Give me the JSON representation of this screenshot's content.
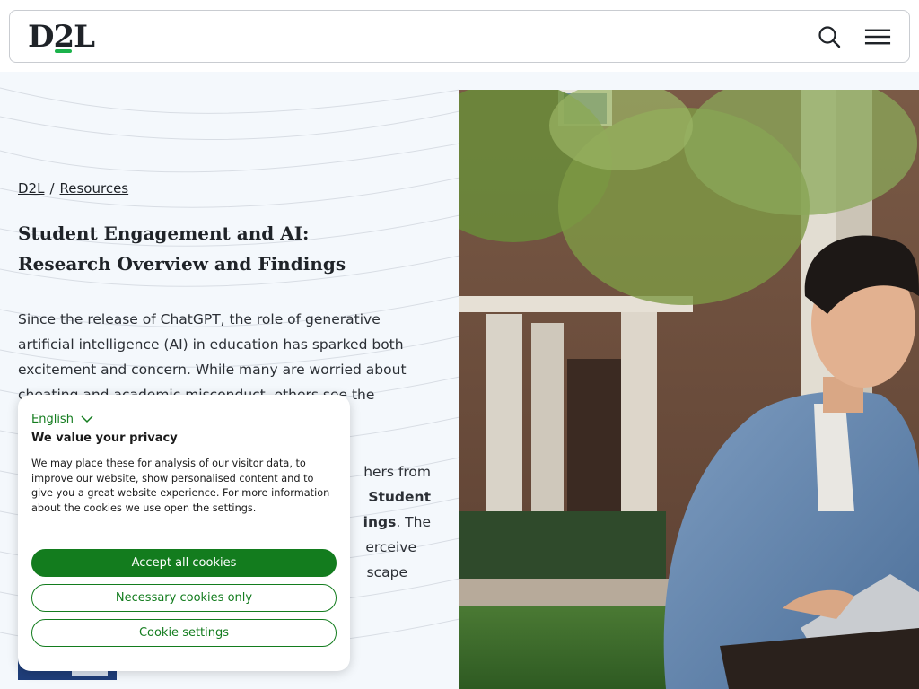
{
  "header": {
    "logo_text_d": "D",
    "logo_text_2": "2",
    "logo_text_l": "L",
    "search_icon": "search-icon",
    "menu_icon": "hamburger-menu-icon"
  },
  "breadcrumb": {
    "home": "D2L",
    "separator": "/",
    "current": "Resources"
  },
  "page": {
    "title_line1": "Student Engagement and AI:",
    "title_line2": "Research Overview and Findings",
    "intro": "Since the release of ChatGPT, the role of generative artificial intelligence (AI) in education has sparked both excitement and concern. While many are worried about cheating and academic misconduct, others see the immense potential for AI",
    "partial_line1": "hers from",
    "partial_line2_bold": "Student",
    "partial_line3_bold": "ings",
    "partial_line3": ". The",
    "partial_line4": "erceive",
    "partial_line5": "scape"
  },
  "cookie": {
    "language": "English",
    "title": "We value your privacy",
    "text": "We may place these for analysis of our visitor data, to improve our website, show personalised content and to give you a great website experience. For more information about the cookies we use open the settings.",
    "accept_all": "Accept all cookies",
    "necessary_only": "Necessary cookies only",
    "settings": "Cookie settings"
  },
  "colors": {
    "brand_green": "#137c1e",
    "logo_accent": "#1bb24b",
    "hero_bg": "#f4f8fc"
  }
}
